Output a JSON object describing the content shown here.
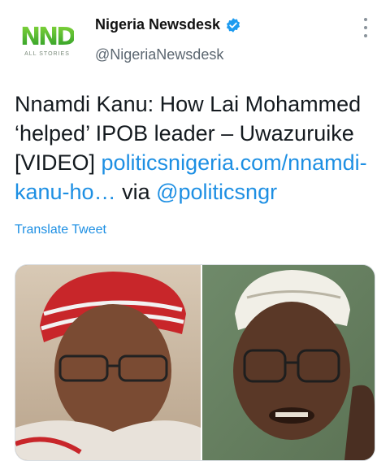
{
  "account": {
    "display_name": "Nigeria Newsdesk",
    "handle": "@NigeriaNewsdesk",
    "verified": true,
    "avatar_logo_text": "NND",
    "avatar_logo_subtitle": "ALL STORIES"
  },
  "tweet": {
    "text_part1": "Nnamdi Kanu: How Lai Mohammed ‘helped’ IPOB leader – Uwazuruike [VIDEO] ",
    "link": "politicsnigeria.com/nnamdi-kanu-ho…",
    "via_text": " via ",
    "mention": "@politicsngr",
    "translate_label": "Translate Tweet"
  },
  "media": {
    "type": "photo",
    "panels": 2
  },
  "colors": {
    "link": "#1d8fe3",
    "verified_badge": "#1d9bf0",
    "logo_green": "#3aa62c"
  },
  "icons": {
    "verified": "verified-badge-icon",
    "more": "more-options-icon"
  }
}
